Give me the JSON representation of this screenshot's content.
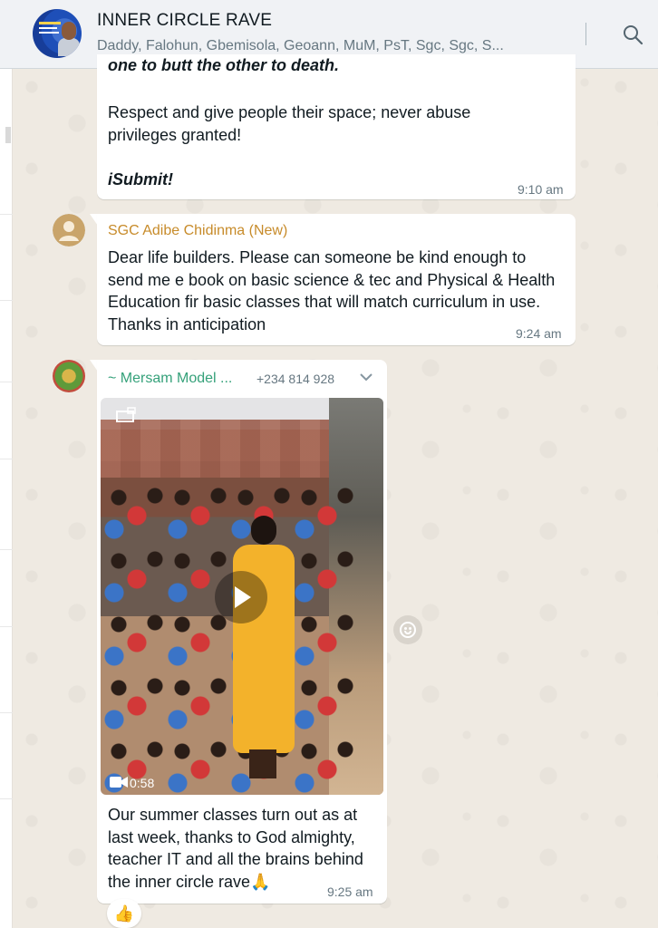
{
  "header": {
    "title": "INNER CIRCLE RAVE",
    "members": "Daddy, Falohun, Gbemisola, Geoann, MuM, PsT, Sgc, Sgc, S..."
  },
  "messages": [
    {
      "cut_text": "one to butt the other to death.",
      "body": "Respect and give people their space; never abuse privileges granted!",
      "closing": "iSubmit!",
      "time": "9:10 am"
    },
    {
      "sender": "SGC Adibe Chidinma (New)",
      "body": "Dear life builders. Please can someone be kind enough to send me e book on basic science & tec and Physical & Health Education fir basic classes that will match curriculum in use. Thanks in anticipation",
      "time": "9:24 am"
    },
    {
      "sender": "~ Mersam Model ...",
      "phone": "+234 814 928",
      "video_duration": "0:58",
      "body": "Our summer classes turn out as at last week, thanks to God almighty, teacher IT and all the brains behind the inner circle rave",
      "emoji": "🙏",
      "time": "9:25 am",
      "reaction": "👍"
    }
  ],
  "colors": {
    "chat_background": "#efeae2",
    "header_background": "#f0f2f5",
    "sender_gold": "#c78b2a",
    "sender_green": "#35a17a"
  },
  "icons": [
    "search-icon",
    "chevron-down-icon",
    "play-icon",
    "video-camera-icon",
    "emoji-icon",
    "default-avatar-icon"
  ]
}
